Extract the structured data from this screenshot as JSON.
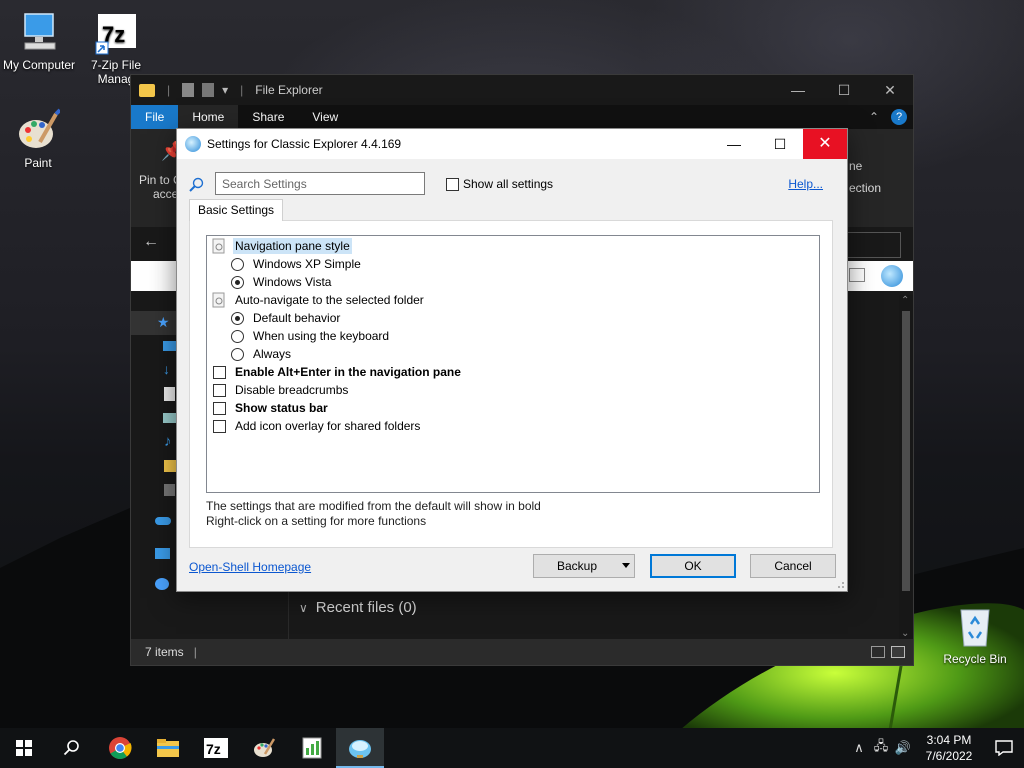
{
  "desktop": {
    "icons": [
      {
        "label": "My Computer"
      },
      {
        "label": "7-Zip File Manag"
      },
      {
        "label": "Paint"
      },
      {
        "label": "Recycle Bin"
      }
    ]
  },
  "explorer": {
    "title": "File Explorer",
    "menu_tabs": [
      "File",
      "Home",
      "Share",
      "View"
    ],
    "ribbon": {
      "pin_label_1": "Pin to C",
      "pin_label_2": "acce",
      "right_label_1": "ne",
      "right_label_2": "ection"
    },
    "recent_files": "Recent files (0)",
    "status_items": "7 items"
  },
  "dialog": {
    "title": "Settings for Classic Explorer 4.4.169",
    "search_placeholder": "Search Settings",
    "show_all_label": "Show all settings",
    "help_label": "Help...",
    "tab_label": "Basic Settings",
    "tree": [
      {
        "type": "group",
        "label": "Navigation pane style",
        "selected": true
      },
      {
        "type": "radio",
        "label": "Windows XP Simple",
        "checked": false
      },
      {
        "type": "radio",
        "label": "Windows Vista",
        "checked": true
      },
      {
        "type": "group",
        "label": "Auto-navigate to the selected folder"
      },
      {
        "type": "radio",
        "label": "Default behavior",
        "checked": true
      },
      {
        "type": "radio",
        "label": "When using the keyboard",
        "checked": false
      },
      {
        "type": "radio",
        "label": "Always",
        "checked": false
      },
      {
        "type": "check",
        "label": "Enable Alt+Enter in the navigation pane",
        "bold": true
      },
      {
        "type": "check",
        "label": "Disable breadcrumbs"
      },
      {
        "type": "check",
        "label": "Show status bar",
        "bold": true
      },
      {
        "type": "check",
        "label": "Add icon overlay for shared folders"
      }
    ],
    "note_1": "The settings that are modified from the default will show in bold",
    "note_2": "Right-click on a setting for more functions",
    "homepage_label": "Open-Shell Homepage",
    "backup_label": "Backup",
    "ok_label": "OK",
    "cancel_label": "Cancel"
  },
  "taskbar": {
    "time": "3:04 PM",
    "date": "7/6/2022",
    "apps": [
      "start-icon",
      "search-icon",
      "chrome-icon",
      "file-explorer-icon",
      "7zip-icon",
      "paint-icon",
      "notepad-chart-icon",
      "classic-shell-icon"
    ]
  },
  "colors": {
    "accent": "#0078d7",
    "close_red": "#e81123",
    "file_tab": "#1979ca",
    "link": "#0b57d0"
  }
}
